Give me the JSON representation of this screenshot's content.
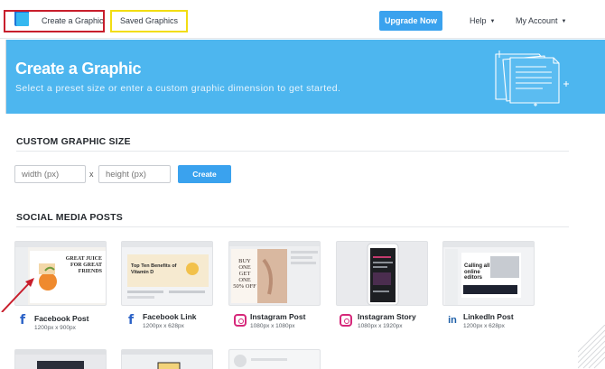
{
  "nav": {
    "create_label": "Create a Graphic",
    "saved_label": "Saved Graphics",
    "upgrade_label": "Upgrade Now",
    "help_label": "Help",
    "account_label": "My Account"
  },
  "hero": {
    "title": "Create a Graphic",
    "subtitle": "Select a preset size or enter a custom graphic dimension to get started."
  },
  "custom": {
    "title": "CUSTOM GRAPHIC SIZE",
    "width_placeholder": "width (px)",
    "height_placeholder": "height (px)",
    "times": "x",
    "create_label": "Create"
  },
  "social": {
    "title": "SOCIAL MEDIA POSTS",
    "items": [
      {
        "title": "Facebook Post",
        "size": "1200px x 900px",
        "icon": "facebook-icon"
      },
      {
        "title": "Facebook Link",
        "size": "1200px x 628px",
        "icon": "facebook-icon"
      },
      {
        "title": "Instagram Post",
        "size": "1080px x 1080px",
        "icon": "instagram-icon"
      },
      {
        "title": "Instagram Story",
        "size": "1080px x 1920px",
        "icon": "instagram-icon"
      },
      {
        "title": "LinkedIn Post",
        "size": "1200px x 628px",
        "icon": "linkedin-icon"
      }
    ]
  },
  "thumbs": {
    "fb_post_text": "GREAT JUICE FOR GREAT FRIENDS",
    "fb_link_text": "Top Ten Benefits of Vitamin D",
    "ig_post_text": "BUY ONE GET ONE 50% OFF",
    "li_post_text": "Calling all online editors"
  },
  "colors": {
    "accent": "#3aa2ee",
    "hero_bg": "#4db6ef",
    "highlight_red": "#c81e2c",
    "highlight_yellow": "#f2dd12",
    "facebook": "#2b62c7",
    "instagram": "#d6287a",
    "linkedin": "#1d5fa8"
  }
}
